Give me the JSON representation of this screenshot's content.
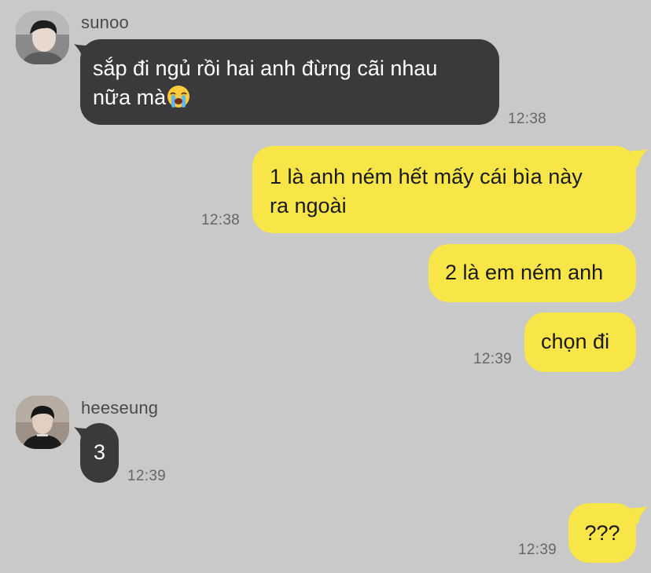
{
  "chat": {
    "messages": [
      {
        "sender": "sunoo",
        "direction": "in",
        "text": "sắp đi ngủ rồi hai anh đừng cãi nhau\nnữa mà",
        "emoji": "loudly-crying-face-emoji",
        "time": "12:38"
      },
      {
        "direction": "out",
        "text": "1 là anh ném hết mấy cái bìa này\nra ngoài",
        "time": "12:38"
      },
      {
        "direction": "out",
        "text": "2 là em ném anh"
      },
      {
        "direction": "out",
        "text": "chọn đi",
        "time": "12:39"
      },
      {
        "sender": "heeseung",
        "direction": "in",
        "text": "3",
        "time": "12:39"
      },
      {
        "direction": "out",
        "text": "???",
        "time": "12:39"
      }
    ]
  },
  "colors": {
    "background": "#c9c9c9",
    "incoming_bubble": "#3a3a3c",
    "outgoing_bubble": "#f8e547",
    "timestamp": "#666666"
  }
}
